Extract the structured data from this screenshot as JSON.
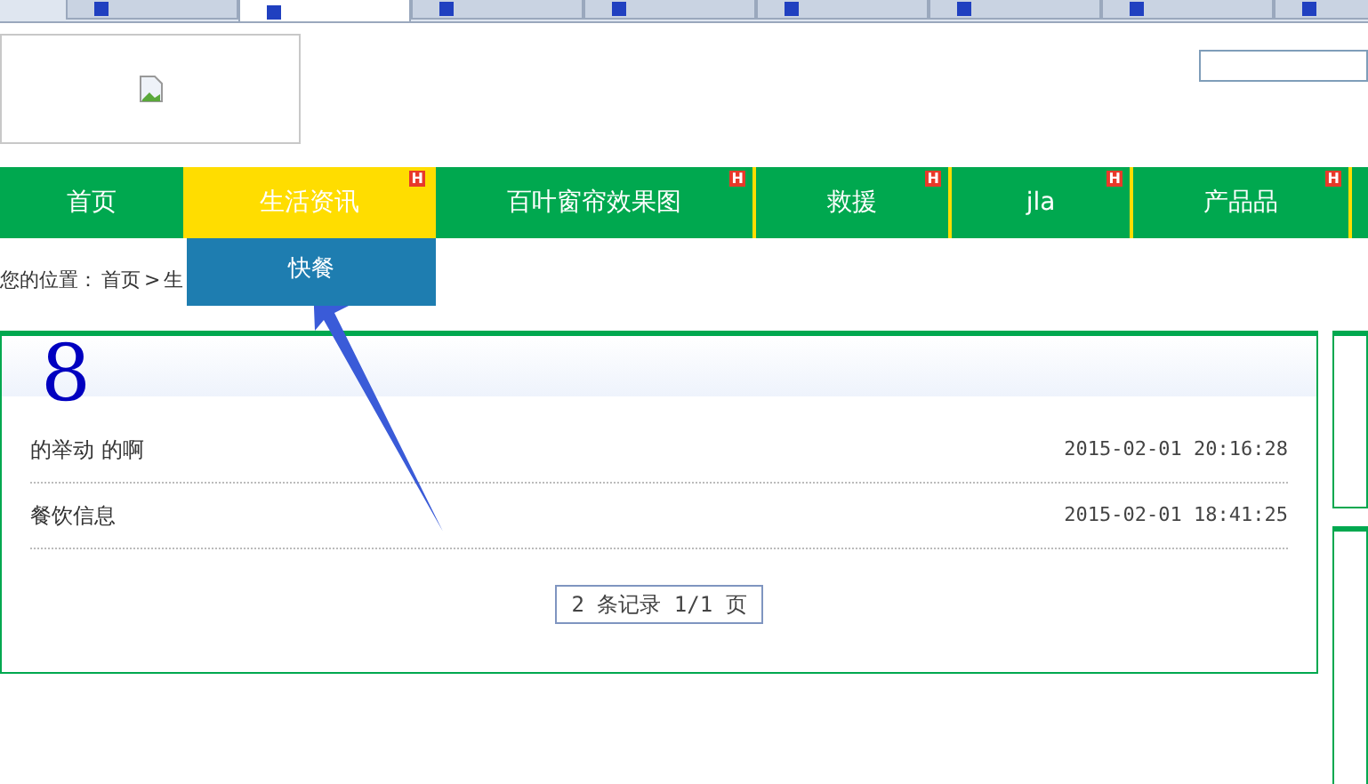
{
  "browser_tabs": [
    {
      "selected": false
    },
    {
      "selected": true
    },
    {
      "selected": false
    },
    {
      "selected": false
    },
    {
      "selected": false
    },
    {
      "selected": false
    },
    {
      "selected": false
    },
    {
      "selected": false
    }
  ],
  "nav": [
    {
      "label": "首页",
      "selected": false
    },
    {
      "label": "生活资讯",
      "selected": true,
      "badge": "H"
    },
    {
      "label": "百叶窗帘效果图",
      "selected": false,
      "badge": "H"
    },
    {
      "label": "救援",
      "selected": false,
      "badge": "H"
    },
    {
      "label": "jla",
      "selected": false,
      "badge": "H"
    },
    {
      "label": "产品品",
      "selected": false,
      "badge": "H"
    }
  ],
  "dropdown": [
    "快餐"
  ],
  "breadcrumb": {
    "label": "您的位置：",
    "home": "首页",
    "separator": ">",
    "current": "生"
  },
  "panel": {
    "title_mark": "8",
    "rows": [
      {
        "title": "的举动 的啊",
        "time": "2015-02-01 20:16:28"
      },
      {
        "title": "餐饮信息",
        "time": "2015-02-01 18:41:25"
      }
    ],
    "pager": "2 条记录 1/1 页"
  }
}
